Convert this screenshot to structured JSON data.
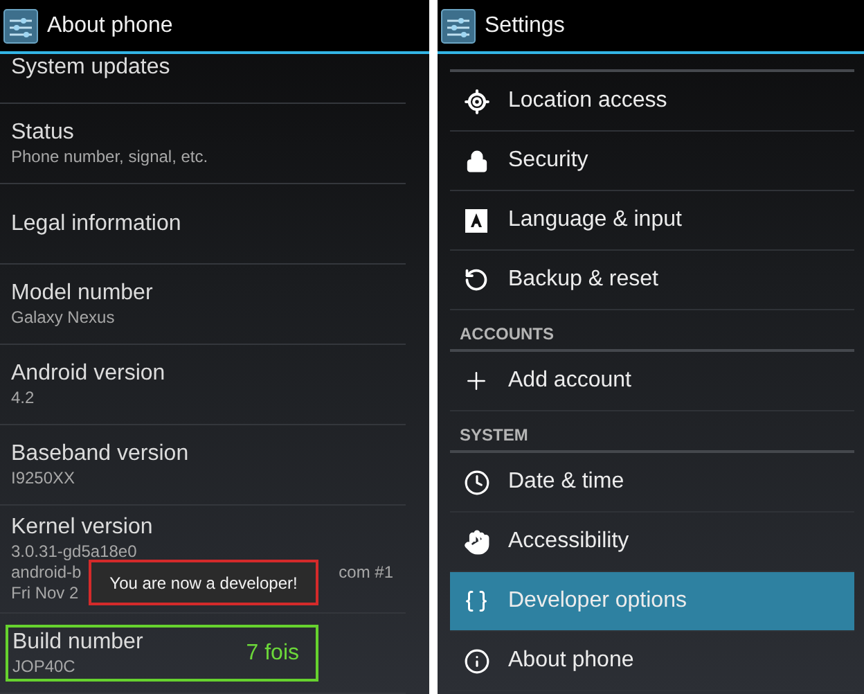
{
  "left_screen": {
    "title": "About phone",
    "items": [
      {
        "kind": "partial",
        "title": "System updates",
        "highlighted": false
      },
      {
        "kind": "item",
        "title": "Status",
        "subtitle": "Phone number, signal, etc.",
        "highlighted": false
      },
      {
        "kind": "item",
        "title": "Legal information",
        "highlighted": false
      },
      {
        "kind": "item",
        "title": "Model number",
        "subtitle": "Galaxy Nexus",
        "highlighted": false
      },
      {
        "kind": "item",
        "title": "Android version",
        "subtitle": "4.2",
        "highlighted": false
      },
      {
        "kind": "item",
        "title": "Baseband version",
        "subtitle": "I9250XX",
        "highlighted": false
      },
      {
        "kind": "kernel",
        "title": "Kernel version",
        "lines": [
          {
            "left": "3.0.31-gd5a18e0"
          },
          {
            "left": "android-b",
            "right": "com #1"
          },
          {
            "left": "Fri Nov 2"
          }
        ],
        "toast": "You are now a developer!",
        "highlighted": false
      },
      {
        "kind": "item",
        "title": "Build number",
        "subtitle": "JOP40C",
        "annotation": "7 fois",
        "highlighted": true
      }
    ]
  },
  "right_screen": {
    "title": "Settings",
    "entries": [
      {
        "kind": "item",
        "label": "Location access",
        "selected": false
      },
      {
        "kind": "item",
        "label": "Security",
        "selected": false
      },
      {
        "kind": "item",
        "label": "Language & input",
        "selected": false
      },
      {
        "kind": "item",
        "label": "Backup & reset",
        "selected": false
      },
      {
        "kind": "header",
        "label": "ACCOUNTS"
      },
      {
        "kind": "item",
        "label": "Add account",
        "selected": false
      },
      {
        "kind": "header",
        "label": "SYSTEM"
      },
      {
        "kind": "item",
        "label": "Date & time",
        "selected": false
      },
      {
        "kind": "item",
        "label": "Accessibility",
        "selected": false
      },
      {
        "kind": "item",
        "label": "Developer options",
        "selected": true
      },
      {
        "kind": "item",
        "label": "About phone",
        "selected": false
      }
    ]
  }
}
